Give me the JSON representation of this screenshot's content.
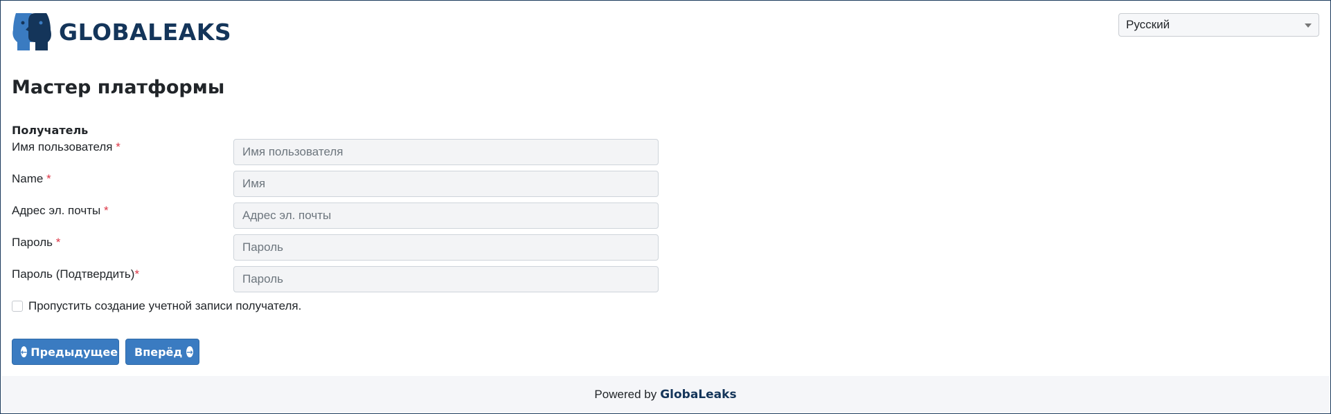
{
  "header": {
    "logo_text": "GLOBALEAKS",
    "language": "Русский"
  },
  "main": {
    "title": "Мастер платформы",
    "section_label": "Получатель",
    "fields": [
      {
        "label": "Имя пользователя",
        "required_mark": "*",
        "placeholder": "Имя пользователя",
        "value": ""
      },
      {
        "label": "Name",
        "required_mark": "*",
        "placeholder": "Имя",
        "value": ""
      },
      {
        "label": "Адрес эл. почты",
        "required_mark": "*",
        "placeholder": "Адрес эл. почты",
        "value": ""
      },
      {
        "label": "Пароль",
        "required_mark": "*",
        "placeholder": "Пароль",
        "value": ""
      },
      {
        "label": "Пароль (Подтвердить)",
        "required_mark": "*",
        "placeholder": "Пароль",
        "value": ""
      }
    ],
    "skip_checkbox": {
      "label": "Пропустить создание учетной записи получателя.",
      "checked": false
    },
    "buttons": {
      "prev": "Предыдущее",
      "next": "Вперёд"
    }
  },
  "footer": {
    "prefix": "Powered by",
    "brand": "GlobaLeaks"
  },
  "colors": {
    "brand_dark": "#14355a",
    "brand_blue": "#3a7bc1",
    "required": "#dc3545"
  },
  "icons": [
    "globaleaks-logo-icon",
    "language-caret-icon",
    "arrow-left-circle-icon",
    "arrow-right-circle-icon"
  ]
}
